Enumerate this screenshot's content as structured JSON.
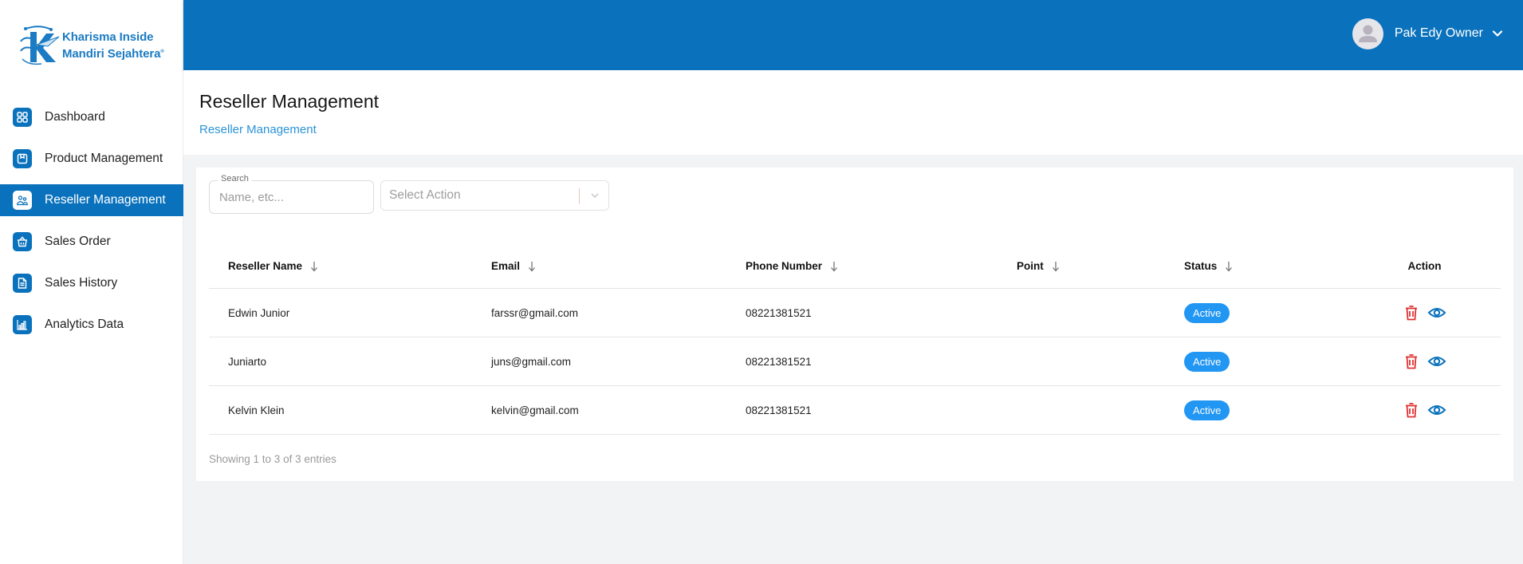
{
  "brand": {
    "line1": "Kharisma Inside",
    "line2": "Mandiri Sejahtera",
    "mark": "®",
    "color": "#1b7bc3"
  },
  "sidebar": {
    "items": [
      {
        "label": "Dashboard",
        "icon": "dashboard-grid-icon",
        "active": false
      },
      {
        "label": "Product Management",
        "icon": "product-box-icon",
        "active": false
      },
      {
        "label": "Reseller Management",
        "icon": "users-icon",
        "active": true
      },
      {
        "label": "Sales Order",
        "icon": "basket-icon",
        "active": false
      },
      {
        "label": "Sales History",
        "icon": "document-icon",
        "active": false
      },
      {
        "label": "Analytics Data",
        "icon": "bar-chart-icon",
        "active": false
      }
    ]
  },
  "topbar": {
    "user_name": "Pak Edy Owner",
    "color": "#0a72bd"
  },
  "page": {
    "title": "Reseller Management",
    "breadcrumb": "Reseller Management"
  },
  "filters": {
    "search_label": "Search",
    "search_placeholder": "Name, etc...",
    "search_value": "",
    "action_placeholder": "Select Action"
  },
  "table": {
    "columns": [
      {
        "label": "Reseller Name",
        "sortable": true
      },
      {
        "label": "Email",
        "sortable": true
      },
      {
        "label": "Phone Number",
        "sortable": true
      },
      {
        "label": "Point",
        "sortable": true
      },
      {
        "label": "Status",
        "sortable": true
      },
      {
        "label": "Action",
        "sortable": false
      }
    ],
    "rows": [
      {
        "name": "Edwin Junior",
        "email": "farssr@gmail.com",
        "phone": "08221381521",
        "point": "",
        "status": "Active"
      },
      {
        "name": "Juniarto",
        "email": "juns@gmail.com",
        "phone": "08221381521",
        "point": "",
        "status": "Active"
      },
      {
        "name": "Kelvin Klein",
        "email": "kelvin@gmail.com",
        "phone": "08221381521",
        "point": "",
        "status": "Active"
      }
    ],
    "footer": "Showing 1 to 3 of 3 entries"
  },
  "colors": {
    "status_active": "#2196f3",
    "delete": "#e03131",
    "view": "#0a72bd"
  }
}
